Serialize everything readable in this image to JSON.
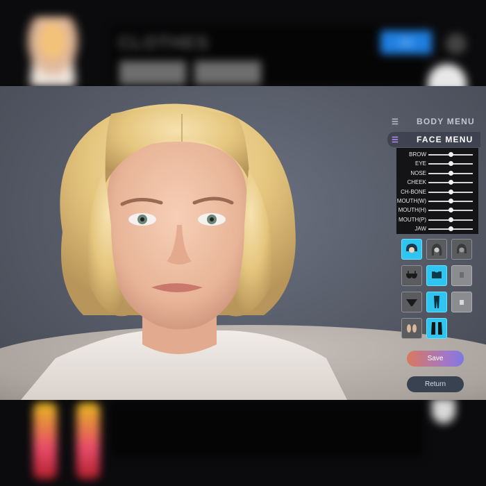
{
  "background": {
    "clothes_title": "CLOTHES",
    "ok_button": "OK"
  },
  "menu": {
    "body_menu_label": "BODY MENU",
    "face_menu_label": "FACE MENU",
    "menu_icon": "list-icon"
  },
  "sliders": [
    {
      "label": "BROW",
      "value": 0.5
    },
    {
      "label": "EYE",
      "value": 0.5
    },
    {
      "label": "NOSE",
      "value": 0.5
    },
    {
      "label": "CHEEK",
      "value": 0.5
    },
    {
      "label": "CH-BONE",
      "value": 0.5
    },
    {
      "label": "MOUTH(W)",
      "value": 0.5
    },
    {
      "label": "MOUTH(H)",
      "value": 0.5
    },
    {
      "label": "MOUTH(P)",
      "value": 0.5
    },
    {
      "label": "JAW",
      "value": 0.5
    }
  ],
  "items": [
    {
      "name": "hair-short-bob-item",
      "icon": "hair-bob-icon",
      "state": "selected"
    },
    {
      "name": "hair-long-item",
      "icon": "hair-long-icon",
      "state": "normal"
    },
    {
      "name": "hair-medium-item",
      "icon": "hair-medium-icon",
      "state": "normal"
    },
    {
      "name": "top-bra-item",
      "icon": "bra-icon",
      "state": "normal"
    },
    {
      "name": "top-crop-item",
      "icon": "crop-top-icon",
      "state": "selected"
    },
    {
      "name": "top-empty-item",
      "icon": "shirt-placeholder-icon",
      "state": "light"
    },
    {
      "name": "bottom-underwear-item",
      "icon": "underwear-icon",
      "state": "normal"
    },
    {
      "name": "bottom-pants-item",
      "icon": "pants-icon",
      "state": "selected"
    },
    {
      "name": "bottom-empty-item",
      "icon": "pants-placeholder-icon",
      "state": "light"
    },
    {
      "name": "shoes-sandals-item",
      "icon": "sandals-icon",
      "state": "normal"
    },
    {
      "name": "shoes-boots-item",
      "icon": "boots-icon",
      "state": "selected"
    }
  ],
  "actions": {
    "save_label": "Save",
    "return_label": "Return"
  },
  "colors": {
    "accent_selected": "#2ec6f0",
    "save_gradient_start": "#d9795e",
    "save_gradient_end": "#7e78e0",
    "return_bg": "#384250",
    "face_menu_icon": "#b08ef0"
  }
}
